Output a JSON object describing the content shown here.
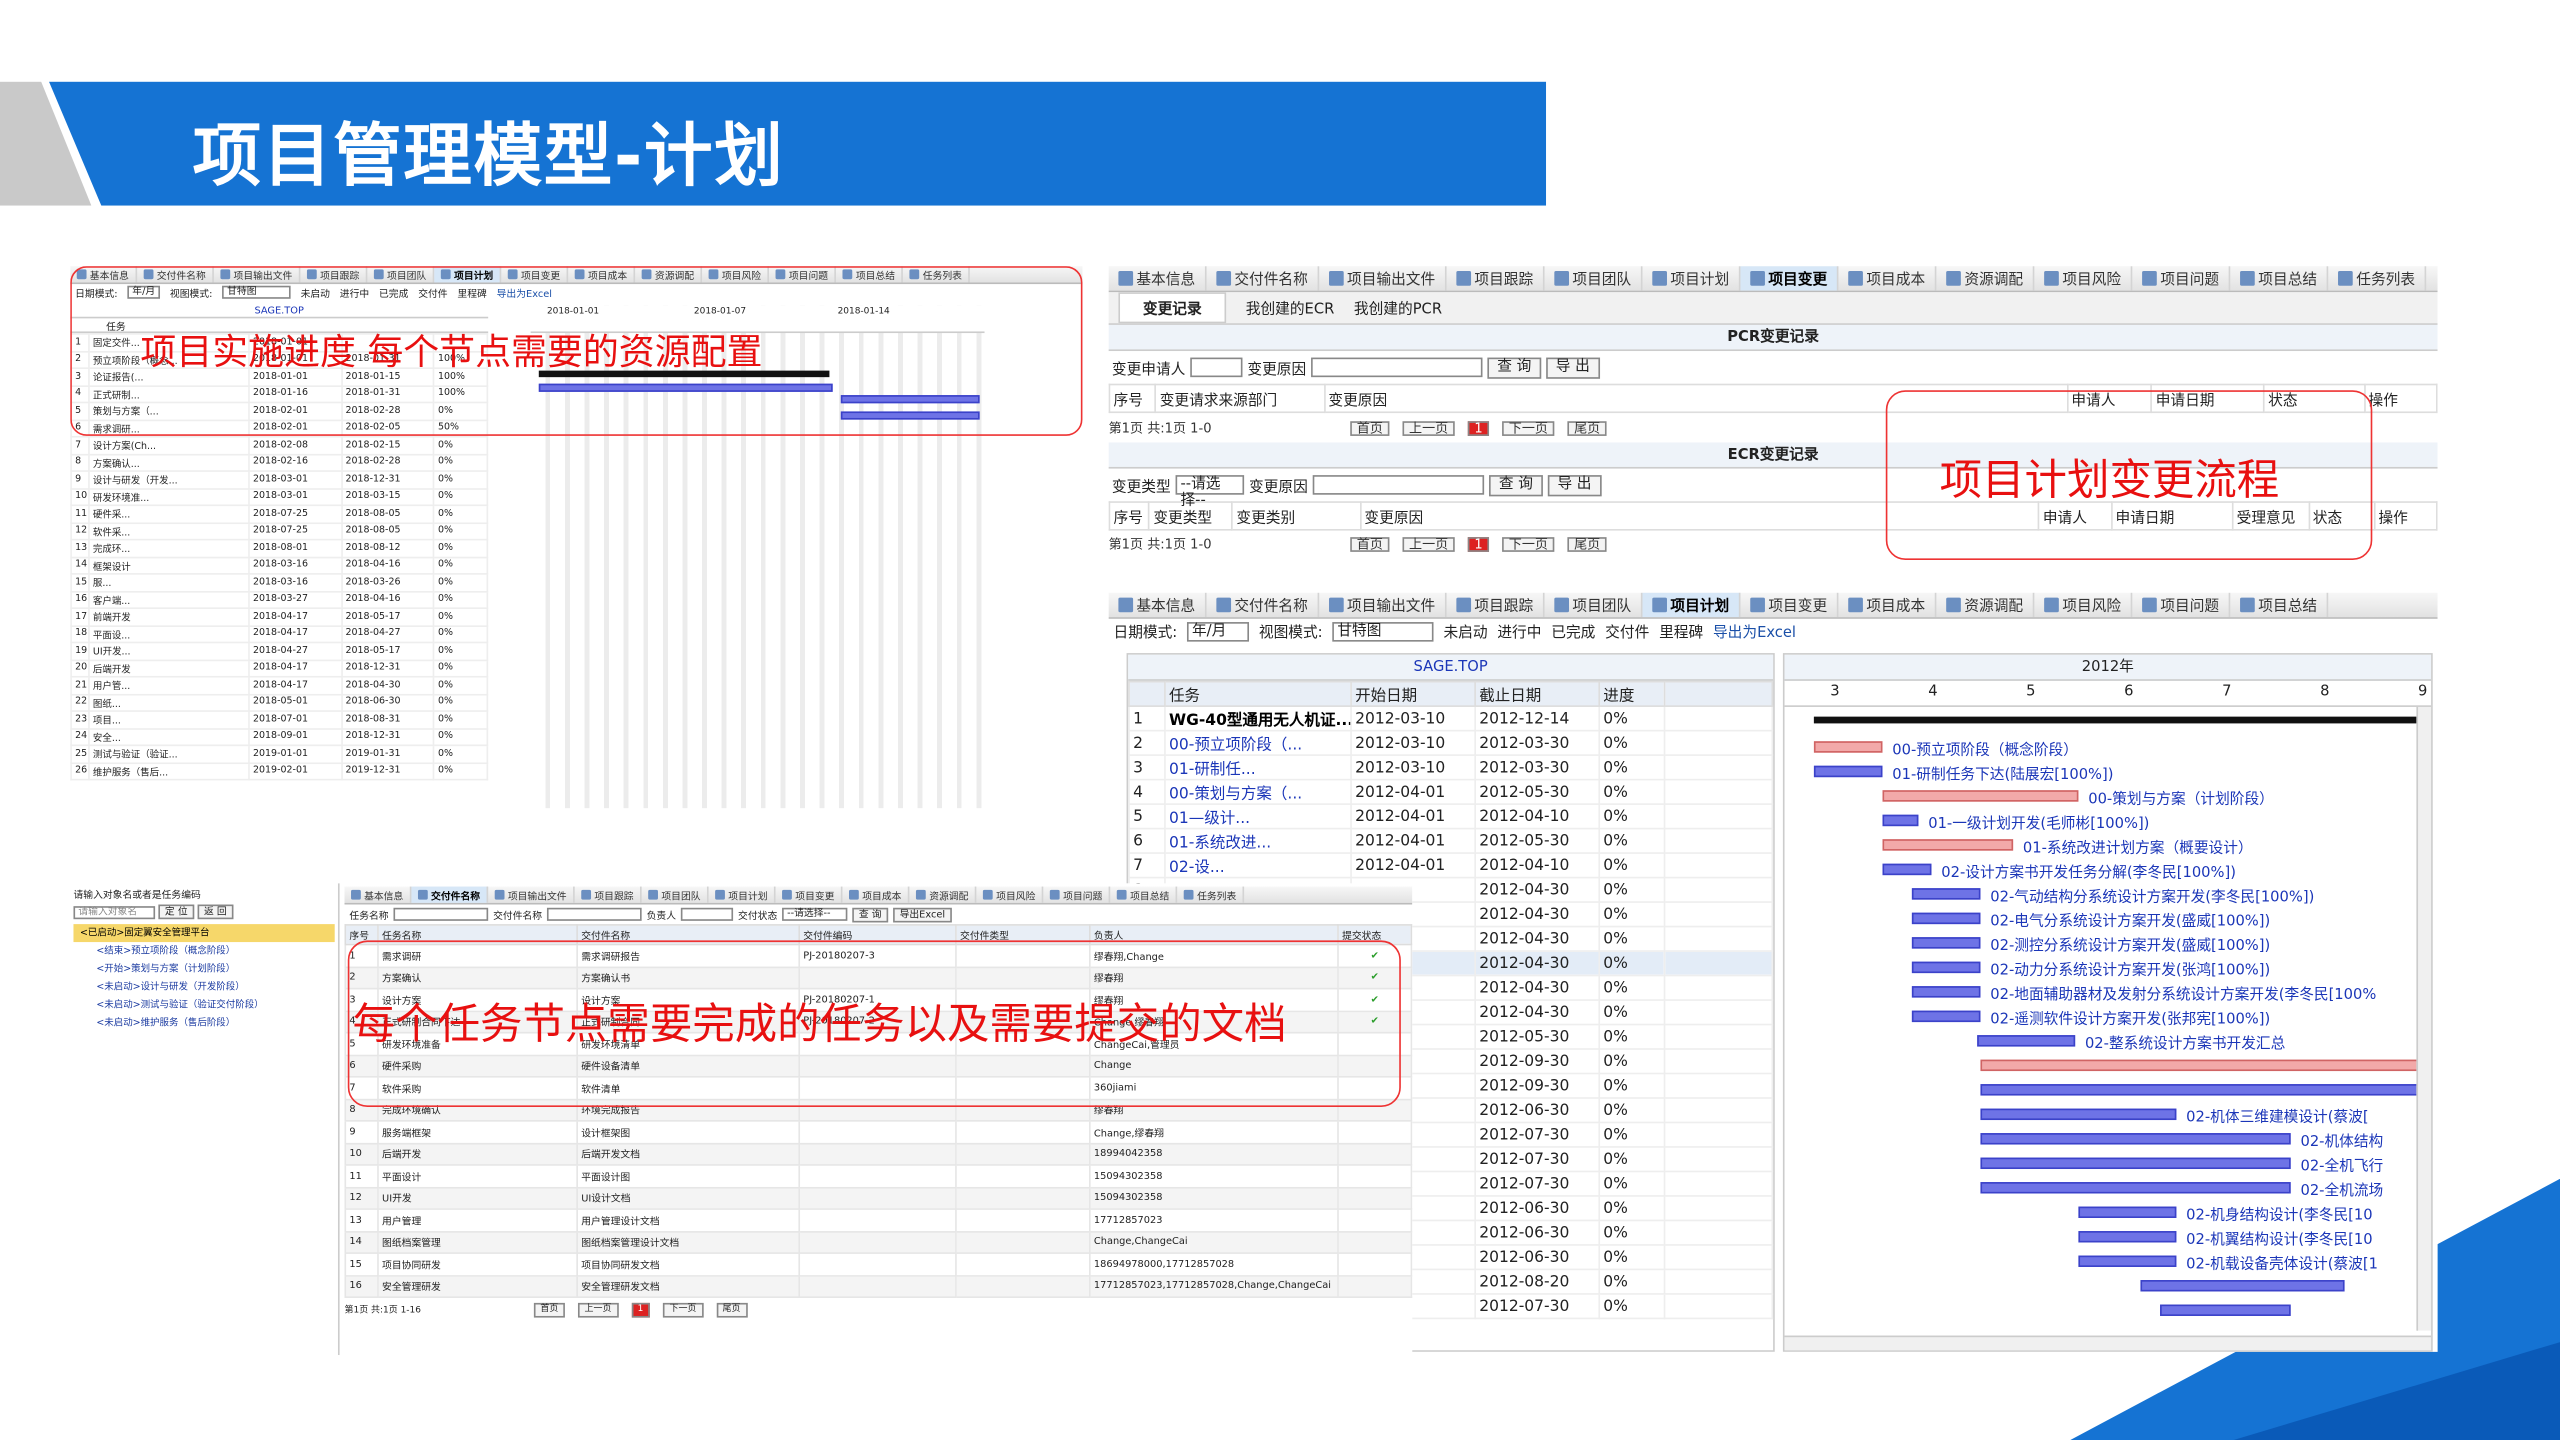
{
  "slide": {
    "title": "项目管理模型-计划"
  },
  "callouts": {
    "progress": "项目实施进度   每个节点需要的资源配置",
    "change": "项目计划变更流程",
    "docs": "每个任务节点需要完成的任务以及需要提交的文档"
  },
  "tabs": [
    "基本信息",
    "交付件名称",
    "项目输出文件",
    "项目跟踪",
    "项目团队",
    "项目计划",
    "项目变更",
    "项目成本",
    "资源调配",
    "项目风险",
    "项目问题",
    "项目总结",
    "任务列表"
  ],
  "tabs_short": [
    "基本信息",
    "交付件名称",
    "项目输出文件",
    "项目跟踪",
    "项目团队",
    "项目计划",
    "项目变更",
    "项目成本",
    "资源调配",
    "项目风险",
    "项目问题",
    "项目总结"
  ],
  "toolbar": {
    "date_mode_label": "日期模式:",
    "date_mode": "年/月",
    "view_mode_label": "视图模式:",
    "view_mode": "甘特图",
    "not_started": "未启动",
    "in_progress": "进行中",
    "done": "已完成",
    "deliverable": "交付件",
    "milestone": "里程碑",
    "export": "导出为Excel"
  },
  "small_gantt": {
    "header": "SAGE.TOP",
    "dates": [
      "2018-01-01",
      "2018-01-07",
      "2018-01-14"
    ],
    "col_task": "任务",
    "rows": [
      [
        "1",
        "固定交件...",
        "2018-01-01",
        "",
        "",
        ""
      ],
      [
        "2",
        "预立项阶段（概念...",
        "2018-01-01",
        "2018-01-31",
        "100%"
      ],
      [
        "3",
        "论证报告(...",
        "2018-01-01",
        "2018-01-15",
        "100%"
      ],
      [
        "4",
        "正式研制...",
        "2018-01-16",
        "2018-01-31",
        "100%"
      ],
      [
        "5",
        "策划与方案（...",
        "2018-02-01",
        "2018-02-28",
        "0%"
      ],
      [
        "6",
        "需求调研...",
        "2018-02-01",
        "2018-02-05",
        "50%"
      ],
      [
        "7",
        "设计方案(Ch...",
        "2018-02-08",
        "2018-02-15",
        "0%"
      ],
      [
        "8",
        "方案确认...",
        "2018-02-16",
        "2018-02-28",
        "0%"
      ],
      [
        "9",
        "设计与研发（开发...",
        "2018-03-01",
        "2018-12-31",
        "0%"
      ],
      [
        "10",
        "研发环境准...",
        "2018-03-01",
        "2018-03-15",
        "0%"
      ],
      [
        "11",
        "硬件采...",
        "2018-07-25",
        "2018-08-05",
        "0%"
      ],
      [
        "12",
        "软件采...",
        "2018-07-25",
        "2018-08-05",
        "0%"
      ],
      [
        "13",
        "完成环...",
        "2018-08-01",
        "2018-08-12",
        "0%"
      ],
      [
        "14",
        "框架设计",
        "2018-03-16",
        "2018-04-16",
        "0%"
      ],
      [
        "15",
        "服...",
        "2018-03-16",
        "2018-03-26",
        "0%"
      ],
      [
        "16",
        "客户端...",
        "2018-03-27",
        "2018-04-16",
        "0%"
      ],
      [
        "17",
        "前端开发",
        "2018-04-17",
        "2018-05-17",
        "0%"
      ],
      [
        "18",
        "平面设...",
        "2018-04-17",
        "2018-04-27",
        "0%"
      ],
      [
        "19",
        "UI开发...",
        "2018-04-27",
        "2018-05-17",
        "0%"
      ],
      [
        "20",
        "后端开发",
        "2018-04-17",
        "2018-12-31",
        "0%"
      ],
      [
        "21",
        "用户管...",
        "2018-04-17",
        "2018-04-30",
        "0%"
      ],
      [
        "22",
        "图纸...",
        "2018-05-01",
        "2018-06-30",
        "0%"
      ],
      [
        "23",
        "项目...",
        "2018-07-01",
        "2018-08-31",
        "0%"
      ],
      [
        "24",
        "安全...",
        "2018-09-01",
        "2018-12-31",
        "0%"
      ],
      [
        "25",
        "测试与验证（验证...",
        "2019-01-01",
        "2019-01-31",
        "0%"
      ],
      [
        "26",
        "维护服务（售后...",
        "2019-02-01",
        "2019-12-31",
        "0%"
      ]
    ]
  },
  "change_panel": {
    "tabs": [
      "变更记录",
      "我创建的ECR",
      "我创建的PCR"
    ],
    "pcr_title": "PCR变更记录",
    "ecr_title": "ECR变更记录",
    "applicant": "变更申请人",
    "reason": "变更原因",
    "query": "查 询",
    "export": "导 出",
    "change_type": "变更类型",
    "change_type_sel": "--请选择--",
    "pcr_cols": [
      "序号",
      "变更请求来源部门",
      "变更原因",
      "申请人",
      "申请日期",
      "状态",
      "操作"
    ],
    "ecr_cols": [
      "序号",
      "变更类型",
      "变更类别",
      "变更原因",
      "申请人",
      "申请日期",
      "受理意见",
      "状态",
      "操作"
    ],
    "pager": "第1页 共:1页 1-0",
    "first": "首页",
    "prev": "上一页",
    "page": "1",
    "next": "下一页",
    "last": "尾页"
  },
  "big_gantt": {
    "header": "SAGE.TOP",
    "year": "2012年",
    "months": [
      "3",
      "4",
      "5",
      "6",
      "7",
      "8",
      "9"
    ],
    "cols": [
      "任务",
      "开始日期",
      "截止日期",
      "进度"
    ],
    "rows": [
      [
        "1",
        "WG-40型通用无人机证...",
        "2012-03-10",
        "2012-12-14",
        "0%"
      ],
      [
        "2",
        "00-预立项阶段（...",
        "2012-03-10",
        "2012-03-30",
        "0%"
      ],
      [
        "3",
        "01-研制任...",
        "2012-03-10",
        "2012-03-30",
        "0%"
      ],
      [
        "4",
        "00-策划与方案（...",
        "2012-04-01",
        "2012-05-30",
        "0%"
      ],
      [
        "5",
        "01—级计...",
        "2012-04-01",
        "2012-04-10",
        "0%"
      ],
      [
        "6",
        "01-系统改进...",
        "2012-04-01",
        "2012-05-30",
        "0%"
      ],
      [
        "7",
        "02-设...",
        "2012-04-01",
        "2012-04-10",
        "0%"
      ],
      [
        "8",
        "",
        "",
        "2012-04-30",
        "0%"
      ],
      [
        "9",
        "",
        "",
        "2012-04-30",
        "0%"
      ],
      [
        "10",
        "",
        "",
        "2012-04-30",
        "0%"
      ],
      [
        "11",
        "",
        "",
        "2012-04-30",
        "0%"
      ],
      [
        "12",
        "",
        "",
        "2012-04-30",
        "0%"
      ],
      [
        "13",
        "",
        "",
        "2012-04-30",
        "0%"
      ],
      [
        "14",
        "",
        "",
        "2012-05-30",
        "0%"
      ],
      [
        "15",
        "",
        "",
        "2012-09-30",
        "0%"
      ],
      [
        "16",
        "",
        "",
        "2012-09-30",
        "0%"
      ],
      [
        "17",
        "",
        "",
        "2012-06-30",
        "0%"
      ],
      [
        "18",
        "",
        "",
        "2012-07-30",
        "0%"
      ],
      [
        "19",
        "",
        "",
        "2012-07-30",
        "0%"
      ],
      [
        "20",
        "",
        "",
        "2012-07-30",
        "0%"
      ],
      [
        "21",
        "",
        "",
        "2012-06-30",
        "0%"
      ],
      [
        "22",
        "",
        "",
        "2012-06-30",
        "0%"
      ],
      [
        "23",
        "",
        "",
        "2012-06-30",
        "0%"
      ],
      [
        "24",
        "",
        "",
        "2012-08-20",
        "0%"
      ],
      [
        "25",
        "",
        "",
        "2012-07-30",
        "0%"
      ]
    ],
    "labels": [
      "00-预立项阶段（概念阶段）",
      "01-研制任务下达(陆展宏[100%])",
      "00-策划与方案（计划阶段）",
      "01-一级计划开发(毛师彬[100%])",
      "01-系统改进计划方案（概要设计）",
      "02-设计方案书开发任务分解(李冬民[100%])",
      "02-气动结构分系统设计方案开发(李冬民[100%])",
      "02-电气分系统设计方案开发(盛威[100%])",
      "02-测控分系统设计方案开发(盛威[100%])",
      "02-动力分系统设计方案开发(张鸿[100%])",
      "02-地面辅助器材及发射分系统设计方案开发(李冬民[100%",
      "02-遥测软件设计方案开发(张邦宪[100%])",
      "02-整系统设计方案书开发汇总",
      "02-机体三维建模设计(蔡波[",
      "02-机体结构",
      "02-全机飞行",
      "02-全机流场",
      "02-机身结构设计(李冬民[10",
      "02-机翼结构设计(李冬民[10",
      "02-机载设备壳体设计(蔡波[1"
    ]
  },
  "docs_panel": {
    "tree_title": "请输入对象名或者是任务编码",
    "tree_input": "请输入对象名",
    "tree_btn1": "定 位",
    "tree_btn2": "返 回",
    "tree": [
      "<已启动>固定翼安全管理平台",
      "<结束>预立项阶段（概念阶段）",
      "<开始>策划与方案（计划阶段）",
      "<未启动>设计与研发（开发阶段）",
      "<未启动>测试与验证（验证交付阶段）",
      "<未启动>维护服务（售后阶段）"
    ],
    "filters": {
      "task": "任务名称",
      "deliverable": "交付件名称",
      "owner": "负责人",
      "status": "交付状态",
      "status_sel": "--请选择--",
      "query": "查 询",
      "export": "导出Excel"
    },
    "cols": [
      "序号",
      "任务名称",
      "交付件名称",
      "交付件编码",
      "交付件类型",
      "负责人",
      "提交状态"
    ],
    "rows": [
      [
        "1",
        "需求调研",
        "需求调研报告",
        "PJ-20180207-3",
        "",
        "缪春翔,Change",
        "✔"
      ],
      [
        "2",
        "方案确认",
        "方案确认书",
        "",
        "",
        "缪春翔",
        "✔"
      ],
      [
        "3",
        "设计方案",
        "设计方案",
        "PJ-20180207-1",
        "",
        "缪春翔",
        "✔"
      ],
      [
        "4",
        "正式研制合同下达",
        "正式研制合同",
        "PJ-20180207-2",
        "",
        "Change,缪春翔",
        "✔"
      ],
      [
        "5",
        "研发环境准备",
        "研发环境清单",
        "",
        "",
        "ChangeCai,管理员",
        ""
      ],
      [
        "6",
        "硬件采购",
        "硬件设备清单",
        "",
        "",
        "Change",
        ""
      ],
      [
        "7",
        "软件采购",
        "软件清单",
        "",
        "",
        "360jiami",
        ""
      ],
      [
        "8",
        "完成环境确认",
        "环境完成报告",
        "",
        "",
        "缪春翔",
        ""
      ],
      [
        "9",
        "服务端框架",
        "设计框架图",
        "",
        "",
        "Change,缪春翔",
        ""
      ],
      [
        "10",
        "后端开发",
        "后端开发文档",
        "",
        "",
        "18994042358",
        ""
      ],
      [
        "11",
        "平面设计",
        "平面设计图",
        "",
        "",
        "15094302358",
        ""
      ],
      [
        "12",
        "UI开发",
        "UI设计文档",
        "",
        "",
        "15094302358",
        ""
      ],
      [
        "13",
        "用户管理",
        "用户管理设计文档",
        "",
        "",
        "17712857023",
        ""
      ],
      [
        "14",
        "图纸档案管理",
        "图纸档案管理设计文档",
        "",
        "",
        "Change,ChangeCai",
        ""
      ],
      [
        "15",
        "项目协同研发",
        "项目协同研发文档",
        "",
        "",
        "18694978000,17712857028",
        ""
      ],
      [
        "16",
        "安全管理研发",
        "安全管理研发文档",
        "",
        "",
        "17712857023,17712857028,Change,ChangeCai",
        ""
      ]
    ],
    "pager": "第1页 共:1页 1-16",
    "first": "首页",
    "prev": "上一页",
    "page": "1",
    "next": "下一页",
    "last": "尾页"
  }
}
